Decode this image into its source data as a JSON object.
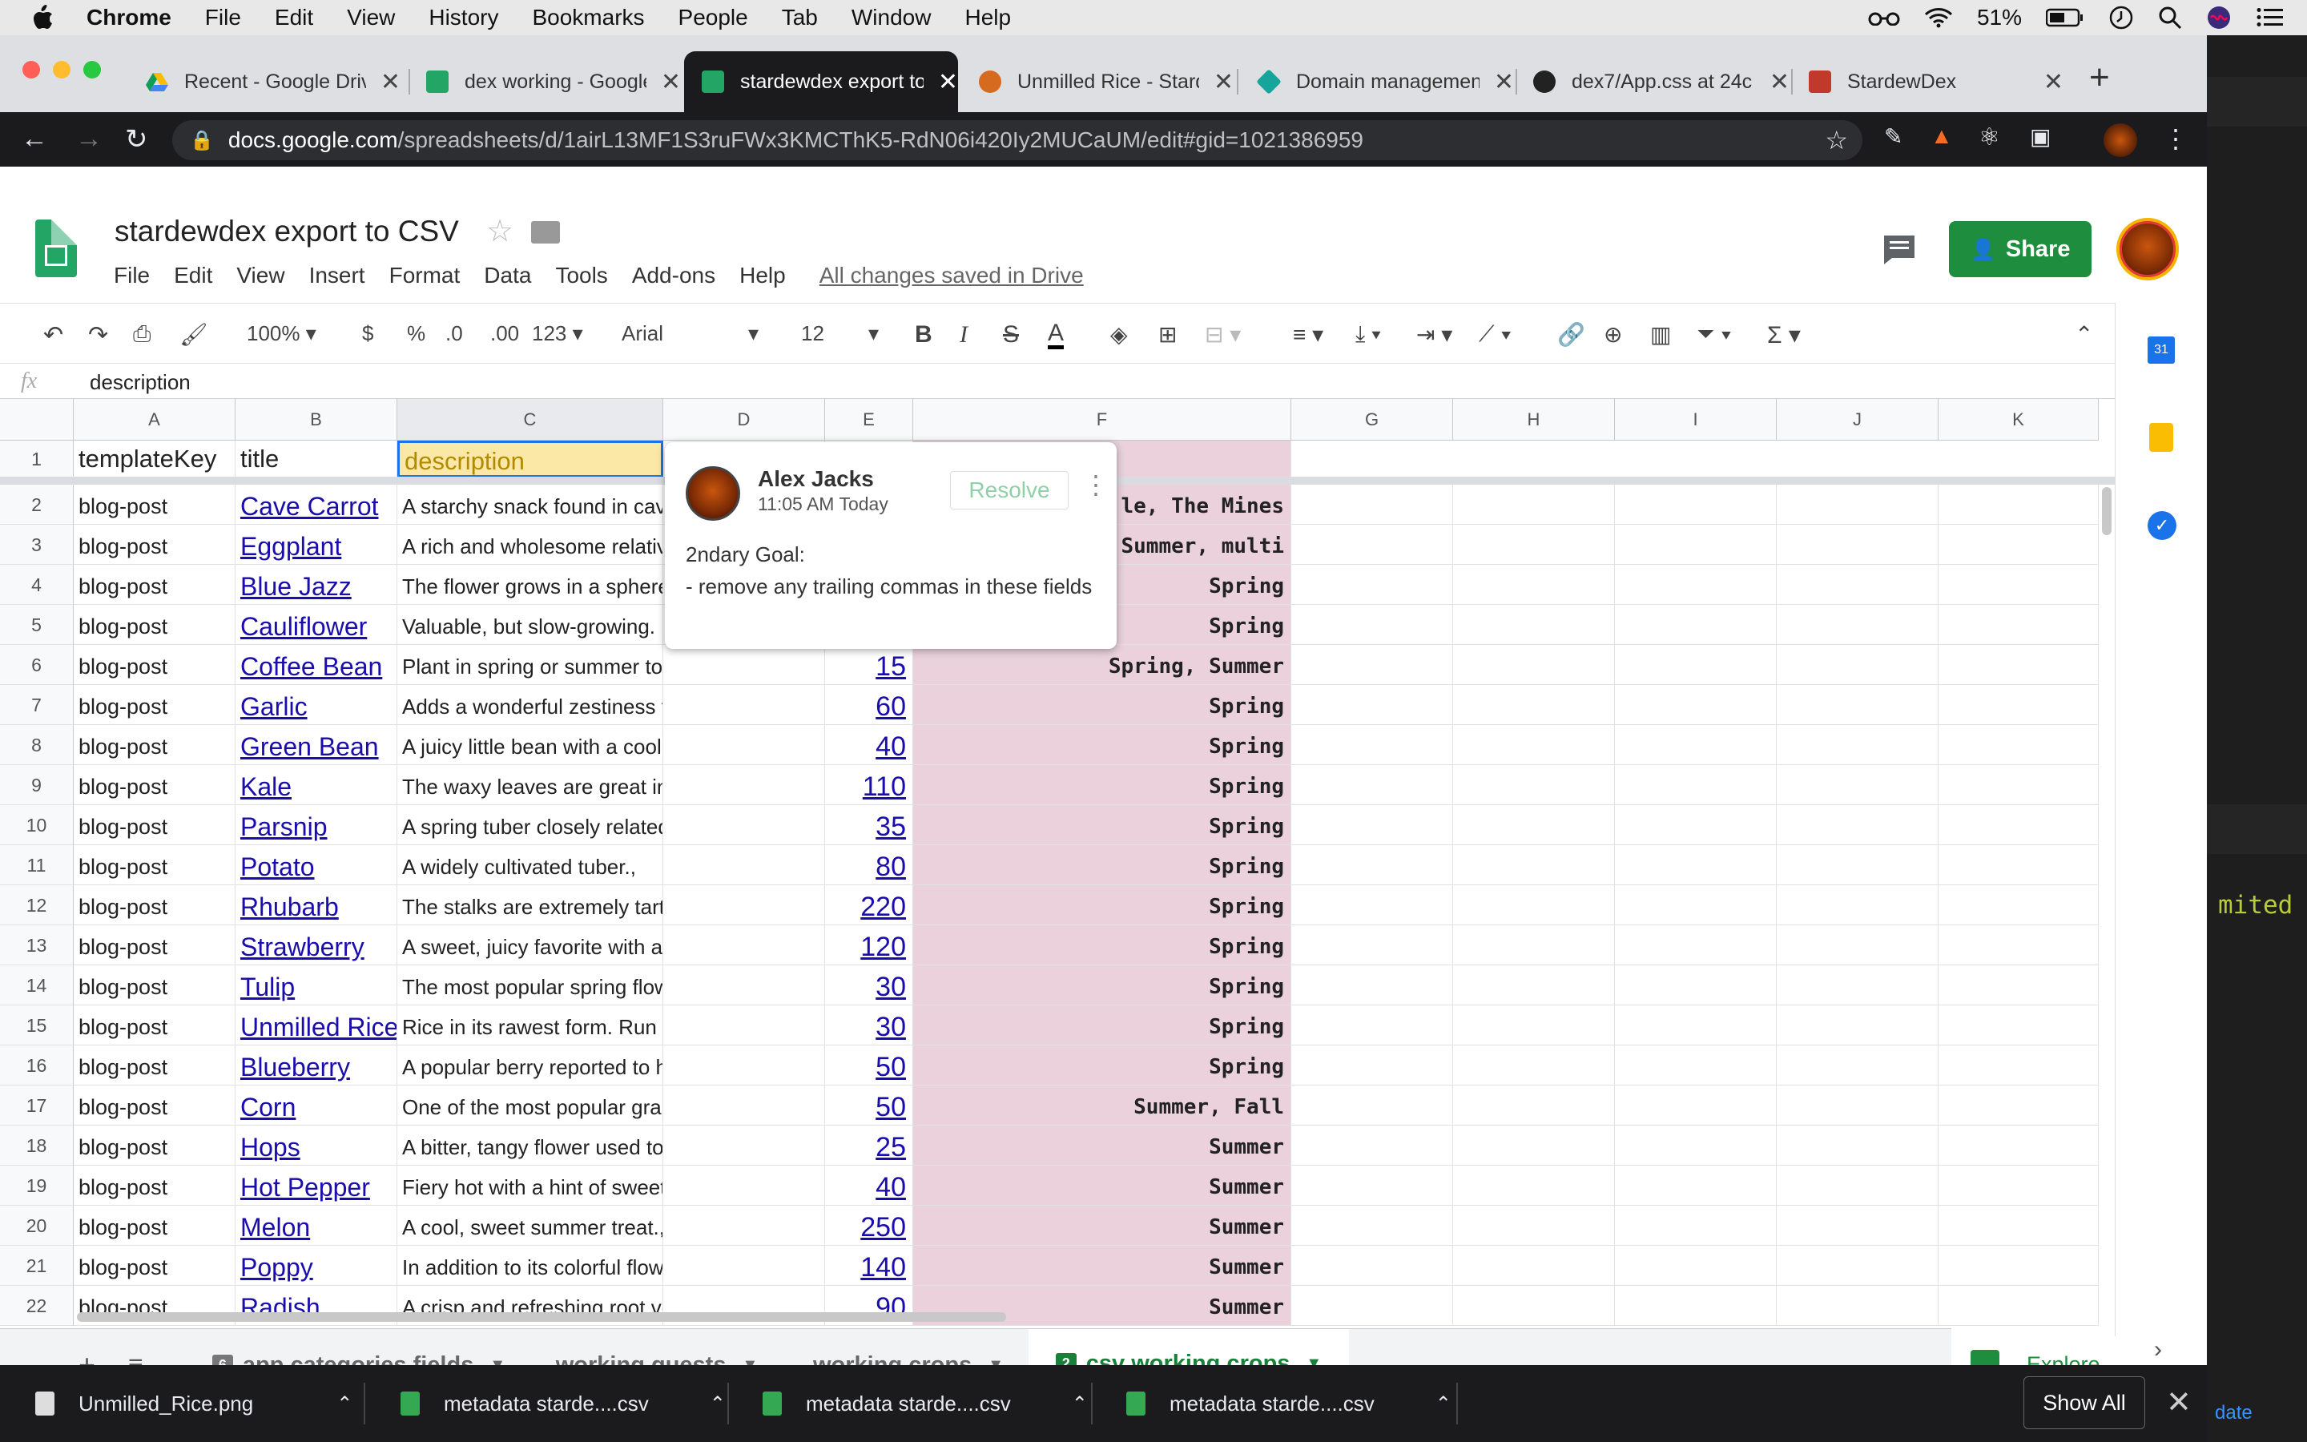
{
  "menubar": {
    "app": "Chrome",
    "items": [
      "File",
      "Edit",
      "View",
      "History",
      "Bookmarks",
      "People",
      "Tab",
      "Window",
      "Help"
    ],
    "battery": "51%"
  },
  "tabs": [
    {
      "title": "Recent - Google Drive",
      "favicon": "google-drive-icon"
    },
    {
      "title": "dex working - Google Sheets",
      "favicon": "sheets-icon"
    },
    {
      "title": "stardewdex export to CSV",
      "favicon": "sheets-icon",
      "active": true
    },
    {
      "title": "Unmilled Rice - Stardew",
      "favicon": "rice-icon"
    },
    {
      "title": "Domain management",
      "favicon": "netlify-icon"
    },
    {
      "title": "dex7/App.css at 24c",
      "favicon": "github-icon"
    },
    {
      "title": "StardewDex",
      "favicon": "stardew-icon"
    }
  ],
  "url": {
    "host": "docs.google.com",
    "path": "/spreadsheets/d/1airL13MF1S3ruFWx3KMCThK5-RdN06i420Iy2MUCaUM/edit#gid=1021386959"
  },
  "doc": {
    "title": "stardewdex export to CSV",
    "menus": [
      "File",
      "Edit",
      "View",
      "Insert",
      "Format",
      "Data",
      "Tools",
      "Add-ons",
      "Help"
    ],
    "saved": "All changes saved in Drive",
    "share": "Share"
  },
  "format_toolbar": {
    "zoom": "100%",
    "currency": "$",
    "percent": "%",
    "dec_less": ".0",
    "dec_more": ".00",
    "more_formats": "123",
    "font": "Arial",
    "font_size": "12"
  },
  "formula_bar": {
    "fx": "fx",
    "value": "description"
  },
  "columns": [
    "A",
    "B",
    "C",
    "D",
    "E",
    "F",
    "G",
    "H",
    "I",
    "J",
    "K"
  ],
  "header_row": {
    "num": "1",
    "a": "templateKey",
    "b": "title",
    "c": "description"
  },
  "rows": [
    {
      "n": "2",
      "a": "blog-post",
      "b": "Cave Carrot",
      "c": "A starchy snack found in cave",
      "e": "",
      "f": "le, The Mines"
    },
    {
      "n": "3",
      "a": "blog-post",
      "b": "Eggplant",
      "c": "A rich and wholesome relative",
      "e": "",
      "f": "Summer, multi"
    },
    {
      "n": "4",
      "a": "blog-post",
      "b": "Blue Jazz",
      "c": "The flower grows in a sphere",
      "e": "",
      "f": "Spring"
    },
    {
      "n": "5",
      "a": "blog-post",
      "b": "Cauliflower",
      "c": "Valuable, but slow-growing. D",
      "e": "",
      "f": "Spring"
    },
    {
      "n": "6",
      "a": "blog-post",
      "b": "Coffee Bean",
      "c": "Plant in spring or summer to grow a coffee pla",
      "e": "15",
      "f": "Spring, Summer"
    },
    {
      "n": "7",
      "a": "blog-post",
      "b": "Garlic",
      "c": "Adds a wonderful zestiness to dishes. High qu",
      "e": "60",
      "f": "Spring"
    },
    {
      "n": "8",
      "a": "blog-post",
      "b": "Green Bean",
      "c": "A juicy little bean with a cool, crisp snap.,",
      "e": "40",
      "f": "Spring"
    },
    {
      "n": "9",
      "a": "blog-post",
      "b": "Kale",
      "c": "The waxy leaves are great in soups and stir fr",
      "e": "110",
      "f": "Spring"
    },
    {
      "n": "10",
      "a": "blog-post",
      "b": "Parsnip",
      "c": "A spring tuber closely related to the carrot. It h",
      "e": "35",
      "f": "Spring"
    },
    {
      "n": "11",
      "a": "blog-post",
      "b": "Potato",
      "c": "A widely cultivated tuber.,",
      "e": "80",
      "f": "Spring"
    },
    {
      "n": "12",
      "a": "blog-post",
      "b": "Rhubarb",
      "c": "The stalks are extremely tart, but make a grea",
      "e": "220",
      "f": "Spring"
    },
    {
      "n": "13",
      "a": "blog-post",
      "b": "Strawberry",
      "c": "A sweet, juicy favorite with an appealing red c",
      "e": "120",
      "f": "Spring"
    },
    {
      "n": "14",
      "a": "blog-post",
      "b": "Tulip",
      "c": "The most popular spring flower. Has a very fai",
      "e": "30",
      "f": "Spring"
    },
    {
      "n": "15",
      "a": "blog-post",
      "b": "Unmilled Rice",
      "c": "Rice in its rawest form. Run this through a mill",
      "e": "30",
      "f": "Spring"
    },
    {
      "n": "16",
      "a": "blog-post",
      "b": "Blueberry",
      "c": "A popular berry reported to have many health",
      "e": "50",
      "f": "Spring"
    },
    {
      "n": "17",
      "a": "blog-post",
      "b": "Corn",
      "c": "One of the most popular grains. The sweet, fre",
      "e": "50",
      "f": "Summer, Fall"
    },
    {
      "n": "18",
      "a": "blog-post",
      "b": "Hops",
      "c": "A bitter, tangy flower used to flavor beer.,",
      "e": "25",
      "f": "Summer"
    },
    {
      "n": "19",
      "a": "blog-post",
      "b": "Hot Pepper",
      "c": "Fiery hot with a hint of sweetness.,",
      "e": "40",
      "f": "Summer"
    },
    {
      "n": "20",
      "a": "blog-post",
      "b": "Melon",
      "c": "A cool, sweet summer treat.,",
      "e": "250",
      "f": "Summer"
    },
    {
      "n": "21",
      "a": "blog-post",
      "b": "Poppy",
      "c": "In addition to its colorful flower, the Poppy has",
      "e": "140",
      "f": "Summer"
    },
    {
      "n": "22",
      "a": "blog-post",
      "b": "Radish",
      "c": "A crisp and refreshing root vegetable with hint",
      "e": "90",
      "f": "Summer"
    }
  ],
  "comment": {
    "author": "Alex Jacks",
    "time": "11:05 AM Today",
    "resolve": "Resolve",
    "line1": "2ndary Goal:",
    "line2": "- remove any trailing commas in these fields"
  },
  "sheet_tabs": [
    {
      "label": "app categories fields",
      "num": "6"
    },
    {
      "label": "working quests"
    },
    {
      "label": "working crops"
    },
    {
      "label": "csv working crops",
      "num": "2",
      "active": true
    }
  ],
  "explore": "Explore",
  "downloads": [
    {
      "name": "Unmilled_Rice.png"
    },
    {
      "name": "metadata starde....csv"
    },
    {
      "name": "metadata starde....csv"
    },
    {
      "name": "metadata starde....csv"
    }
  ],
  "show_all": "Show All",
  "bg_editor": {
    "text": "mited",
    "link": "date"
  },
  "colors": {
    "accent": "#1e8e3e",
    "highlight": "#ead1dc",
    "link": "#1a0dab"
  }
}
